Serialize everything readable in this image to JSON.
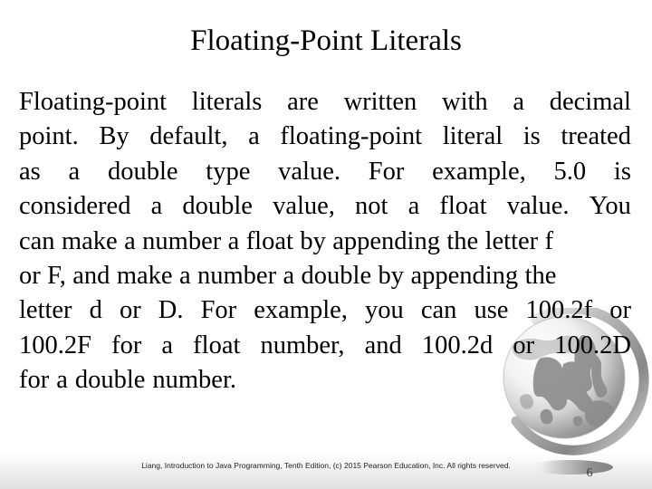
{
  "slide": {
    "title": "Floating-Point Literals",
    "background_color": "#ffffff",
    "text_color": "#000000"
  },
  "body": {
    "full_text": "Floating-point literals are written with a decimal point. By default, a floating-point literal is treated as a double type value. For example, 5.0 is considered a double value, not a float value. You can make a number a float by appending the letter f or F, and make a number a double by appending the letter d or D. For example, you can use 100.2f or 100.2F for a float number, and 100.2d or 100.2D for a double number.",
    "lines": [
      [
        "Floating-point",
        "literals",
        "are",
        "written",
        "with",
        "a",
        "decimal"
      ],
      [
        "point.",
        "By",
        "default,",
        "a",
        "floating-point",
        "literal",
        "is",
        "treated"
      ],
      [
        "as",
        "a",
        "double",
        "type",
        "value.",
        "For",
        "example,",
        "5.0",
        "is"
      ],
      [
        "considered",
        "a",
        "double",
        "value,",
        "not",
        "a",
        "float",
        "value.",
        "You"
      ],
      [
        "can",
        "make",
        "a",
        "number",
        "a",
        "float",
        "by",
        "appending",
        "the",
        "letter",
        "f"
      ],
      [
        "or",
        "F,",
        "and",
        "make",
        "a",
        "number",
        "a",
        "double",
        "by",
        "appending",
        "the"
      ],
      [
        "letter",
        "d",
        "or",
        "D.",
        "For",
        "example,",
        "you",
        "can",
        "use",
        "100.2f",
        "or"
      ],
      [
        "100.2F",
        "for",
        "a",
        "float",
        "number,",
        "and",
        "100.2d",
        "or",
        "100.2D"
      ],
      [
        "for",
        "a",
        "double",
        "number."
      ]
    ]
  },
  "footer": {
    "credit": "Liang, Introduction to Java Programming, Tenth Edition, (c) 2015 Pearson Education, Inc. All rights reserved.",
    "page_number": "6"
  },
  "graphics": {
    "globe": {
      "name": "globe-watermark",
      "description": "grayscale globe with continents, surrounding arc ring and cast shadow ellipse",
      "light_gray": "#e8e8e8",
      "mid_gray": "#9a9a9a",
      "dark_gray": "#5e5e5e"
    },
    "bottom_band": {
      "name": "bottom-gradient-band",
      "from_color": "#ffffff",
      "to_color": "#dfdfdf"
    }
  }
}
